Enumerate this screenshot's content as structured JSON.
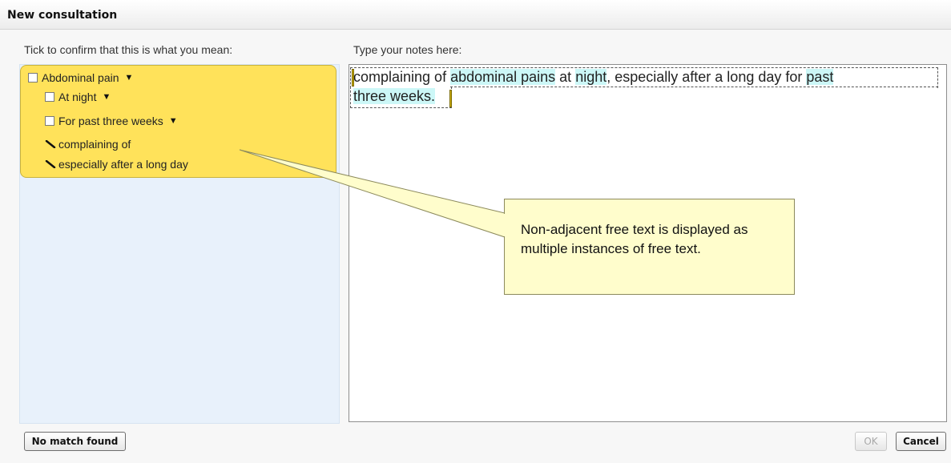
{
  "window": {
    "title": "New consultation"
  },
  "left_panel": {
    "label": "Tick to confirm that this is what you mean:",
    "concept": {
      "label": "Abdominal pain",
      "children": [
        {
          "label": "At night"
        },
        {
          "label": "For past three weeks"
        }
      ],
      "free_text": [
        {
          "label": "complaining of"
        },
        {
          "label": "especially after a long day"
        }
      ]
    }
  },
  "notes": {
    "label": "Type your notes here:",
    "line1": [
      {
        "text": "complaining of ",
        "highlight": false
      },
      {
        "text": "abdominal pains",
        "highlight": true
      },
      {
        "text": " at ",
        "highlight": false
      },
      {
        "text": "night",
        "highlight": true
      },
      {
        "text": ", especially after a long day for ",
        "highlight": false
      },
      {
        "text": "past",
        "highlight": true
      }
    ],
    "line2": [
      {
        "text": "three weeks.",
        "highlight": true
      }
    ]
  },
  "callout": {
    "text": "Non-adjacent free text is displayed as multiple instances of free text."
  },
  "footer": {
    "no_match_label": "No match found",
    "ok_label": "OK",
    "cancel_label": "Cancel"
  },
  "colors": {
    "concept_bg": "#ffe25a",
    "left_pane_bg": "#e8f1fb",
    "highlight": "#ccf7f7",
    "callout_bg": "#fffdcc"
  }
}
